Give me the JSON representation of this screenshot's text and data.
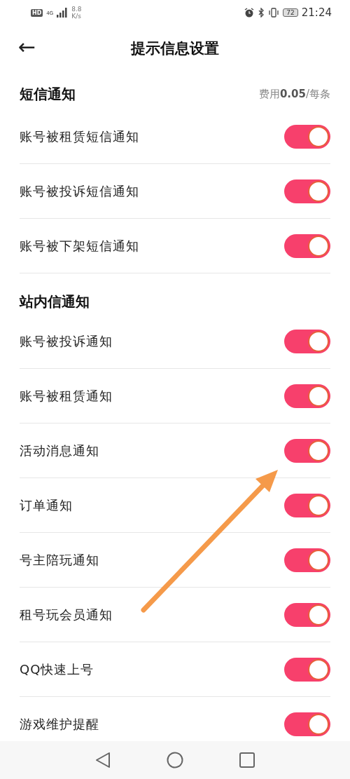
{
  "status_bar": {
    "hd": "HD",
    "network": "4G",
    "speed_value": "8.8",
    "speed_unit": "K/s",
    "battery": "72",
    "time": "21:24"
  },
  "header": {
    "back": "←",
    "title": "提示信息设置"
  },
  "sections": [
    {
      "title": "短信通知",
      "note": "费用**0.05**/每条",
      "items": [
        {
          "label": "账号被租赁短信通知",
          "on": true
        },
        {
          "label": "账号被投诉短信通知",
          "on": true
        },
        {
          "label": "账号被下架短信通知",
          "on": true
        }
      ]
    },
    {
      "title": "站内信通知",
      "items": [
        {
          "label": "账号被投诉通知",
          "on": true
        },
        {
          "label": "账号被租赁通知",
          "on": true
        },
        {
          "label": "活动消息通知",
          "on": true
        },
        {
          "label": "订单通知",
          "on": true
        },
        {
          "label": "号主陪玩通知",
          "on": true
        },
        {
          "label": "租号玩会员通知",
          "on": true
        },
        {
          "label": "QQ快速上号",
          "on": true
        },
        {
          "label": "游戏维护提醒",
          "on": true
        }
      ]
    }
  ]
}
